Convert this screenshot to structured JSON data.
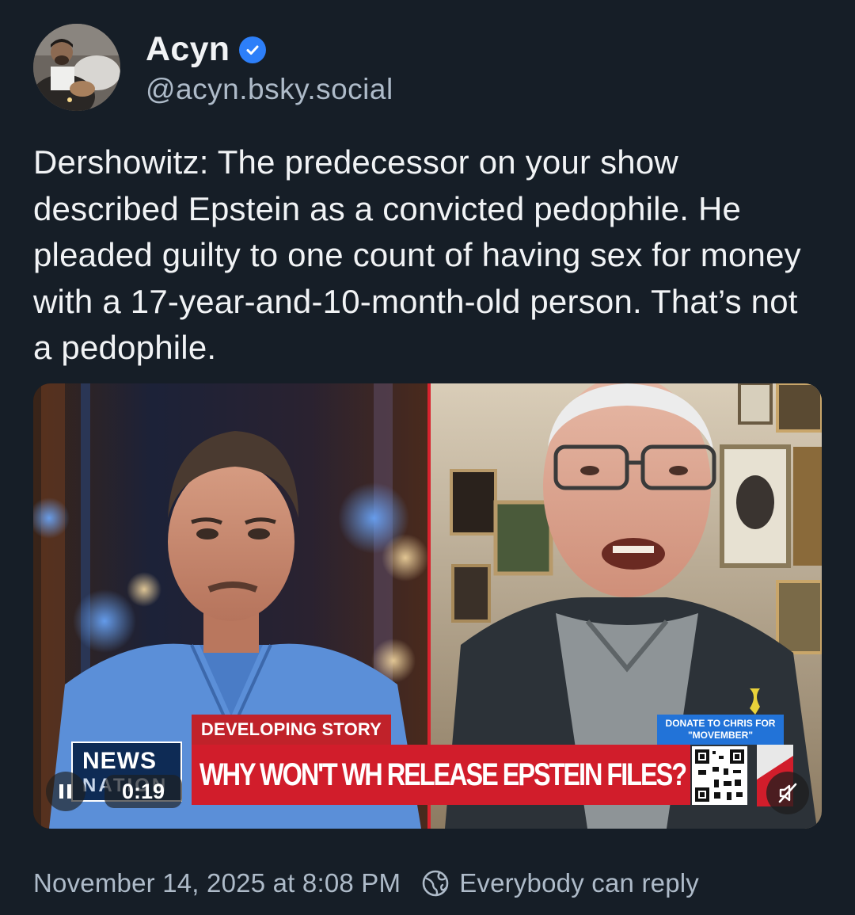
{
  "author": {
    "display_name": "Acyn",
    "handle": "@acyn.bsky.social",
    "verified": true,
    "avatar_icon": "avatar-photo"
  },
  "post": {
    "text": "Dershowitz: The predecessor on your show described Epstein as a convicted pedophile. He pleaded guilty to one count of having sex for money with a 17-year-and-10-month-old person. That’s not a pedophile."
  },
  "video": {
    "lower_third_label": "DEVELOPING STORY",
    "headline": "WHY WON'T WH RELEASE EPSTEIN FILES?",
    "network_logo_line1": "NEWS",
    "network_logo_line2": "NATION",
    "donate_text": "DONATE TO CHRIS FOR \"MOVEMBER\"",
    "elapsed_time": "0:19",
    "playback_state": "playing",
    "muted": true,
    "colors": {
      "lower_third_red": "#d11d2b",
      "donate_blue": "#2273d8",
      "divider_red": "#d9232e"
    }
  },
  "footer": {
    "timestamp": "November 14, 2025 at 8:08 PM",
    "reply_setting": "Everybody can reply",
    "reply_icon": "globe-icon"
  },
  "colors": {
    "background": "#161e27",
    "text_primary": "#f1f3f5",
    "text_secondary": "#aebbc9",
    "verified_blue": "#2d7ff9"
  }
}
